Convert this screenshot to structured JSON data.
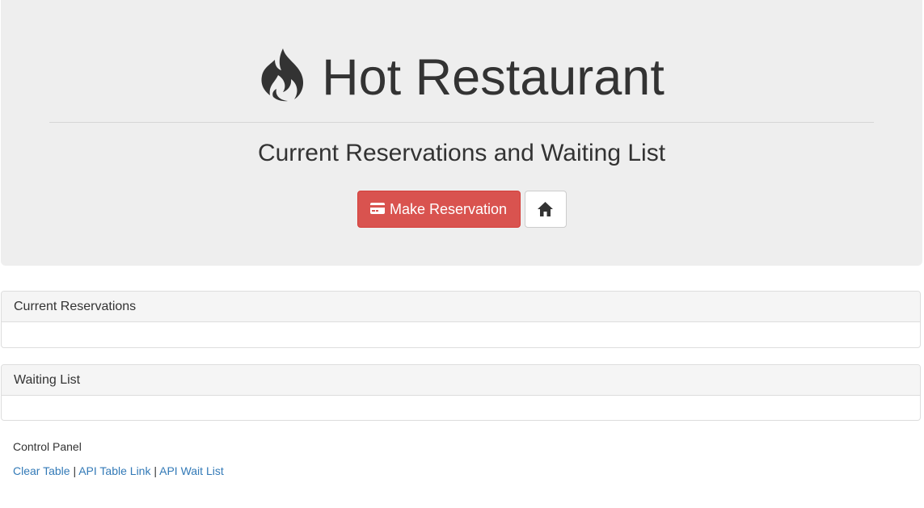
{
  "header": {
    "title": "Hot Restaurant",
    "subtitle": "Current Reservations and Waiting List",
    "icon": "fire-icon"
  },
  "buttons": {
    "make_reservation_label": "Make Reservation",
    "make_reservation_icon": "credit-card-icon",
    "home_icon": "home-icon"
  },
  "panels": {
    "reservations_title": "Current Reservations",
    "waiting_title": "Waiting List"
  },
  "control_panel": {
    "label": "Control Panel",
    "links": [
      "Clear Table",
      "API Table Link",
      "API Wait List"
    ],
    "separator": "|"
  },
  "colors": {
    "jumbotron_bg": "#eeeeee",
    "danger": "#d9534f",
    "link": "#337ab7"
  }
}
